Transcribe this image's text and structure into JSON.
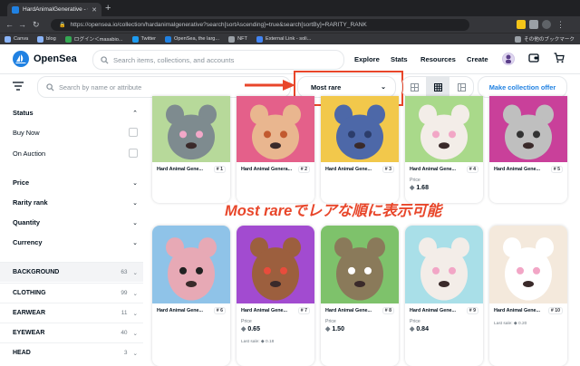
{
  "browser": {
    "tab_title": "HardAnimalGenerative - Colle",
    "url": "https://opensea.io/collection/hardanimalgenerative?search[sortAscending]=true&search[sortBy]=RARITY_RANK",
    "bookmarks": [
      "Canva",
      "blog",
      "ログイン＜masabio...",
      "Twitter",
      "OpenSea, the larg...",
      "NFT",
      "External Link - soli..."
    ],
    "other_bookmarks": "その他のブックマーク"
  },
  "header": {
    "brand": "OpenSea",
    "search_placeholder": "Search items, collections, and accounts",
    "nav": [
      "Explore",
      "Stats",
      "Resources",
      "Create"
    ]
  },
  "toolbar": {
    "filter_placeholder": "Search by name or attribute",
    "sort_selected": "Most rare",
    "offer_button": "Make collection offer"
  },
  "sidebar": {
    "status_label": "Status",
    "status_options": [
      "Buy Now",
      "On Auction"
    ],
    "sections": [
      "Price",
      "Rarity rank",
      "Quantity",
      "Currency"
    ],
    "traits": [
      {
        "name": "BACKGROUND",
        "count": "63"
      },
      {
        "name": "CLOTHING",
        "count": "99"
      },
      {
        "name": "EARWEAR",
        "count": "11"
      },
      {
        "name": "EYEWEAR",
        "count": "40"
      },
      {
        "name": "HEAD",
        "count": "3"
      }
    ]
  },
  "cards": [
    {
      "name": "Hard Animal Gene...",
      "rank": "# 1",
      "price_label": "",
      "price": "",
      "last_sale": "",
      "bg": "#b7d99a",
      "animal": "#7e8b8f",
      "accent": "#f2a8c8"
    },
    {
      "name": "Hard Animal Genera...",
      "rank": "# 2",
      "price_label": "",
      "price": "",
      "last_sale": "",
      "bg": "#e4608a",
      "animal": "#e9b68f",
      "accent": "#c25a2f"
    },
    {
      "name": "Hard Animal Gene...",
      "rank": "# 3",
      "price_label": "",
      "price": "",
      "last_sale": "",
      "bg": "#f2c84b",
      "animal": "#4d68a8",
      "accent": "#2c3d6b"
    },
    {
      "name": "Hard Animal Gene...",
      "rank": "# 4",
      "price_label": "Price",
      "price": "1.68",
      "last_sale": "",
      "bg": "#a9d98a",
      "animal": "#f3ede8",
      "accent": "#f2a6c6"
    },
    {
      "name": "Hard Animal Gene...",
      "rank": "# 5",
      "price_label": "",
      "price": "",
      "last_sale": "",
      "bg": "#c9409a",
      "animal": "#bfbfbf",
      "accent": "#333333"
    },
    {
      "name": "Hard Animal Gene...",
      "rank": "# 6",
      "price_label": "",
      "price": "",
      "last_sale": "",
      "bg": "#8fc3e8",
      "animal": "#e7a9b5",
      "accent": "#222222"
    },
    {
      "name": "Hard Animal Gene...",
      "rank": "# 7",
      "price_label": "Price",
      "price": "0.65",
      "last_sale": "Last sale:",
      "last_sale_value": "0.18",
      "bg": "#a24bd0",
      "animal": "#9c5f3e",
      "accent": "#e84c3c"
    },
    {
      "name": "Hard Animal Gene...",
      "rank": "# 8",
      "price_label": "Price",
      "price": "1.50",
      "last_sale": "",
      "bg": "#7ec26b",
      "animal": "#8a7a5a",
      "accent": "#ffffff"
    },
    {
      "name": "Hard Animal Gene...",
      "rank": "# 9",
      "price_label": "Price",
      "price": "0.84",
      "last_sale": "",
      "bg": "#a9dfe8",
      "animal": "#f3ede8",
      "accent": "#f2a6c6"
    },
    {
      "name": "Hard Animal Gene...",
      "rank": "# 10",
      "price_label": "",
      "price": "",
      "last_sale": "Last sale:",
      "last_sale_value": "0.20",
      "bg": "#f4e9dc",
      "animal": "#ffffff",
      "accent": "#f2a6c6"
    }
  ],
  "annotation": "Most rareでレアな順に表示可能",
  "colors": {
    "accent": "#2081e2",
    "highlight": "#e8462a",
    "text": "#04111d"
  }
}
